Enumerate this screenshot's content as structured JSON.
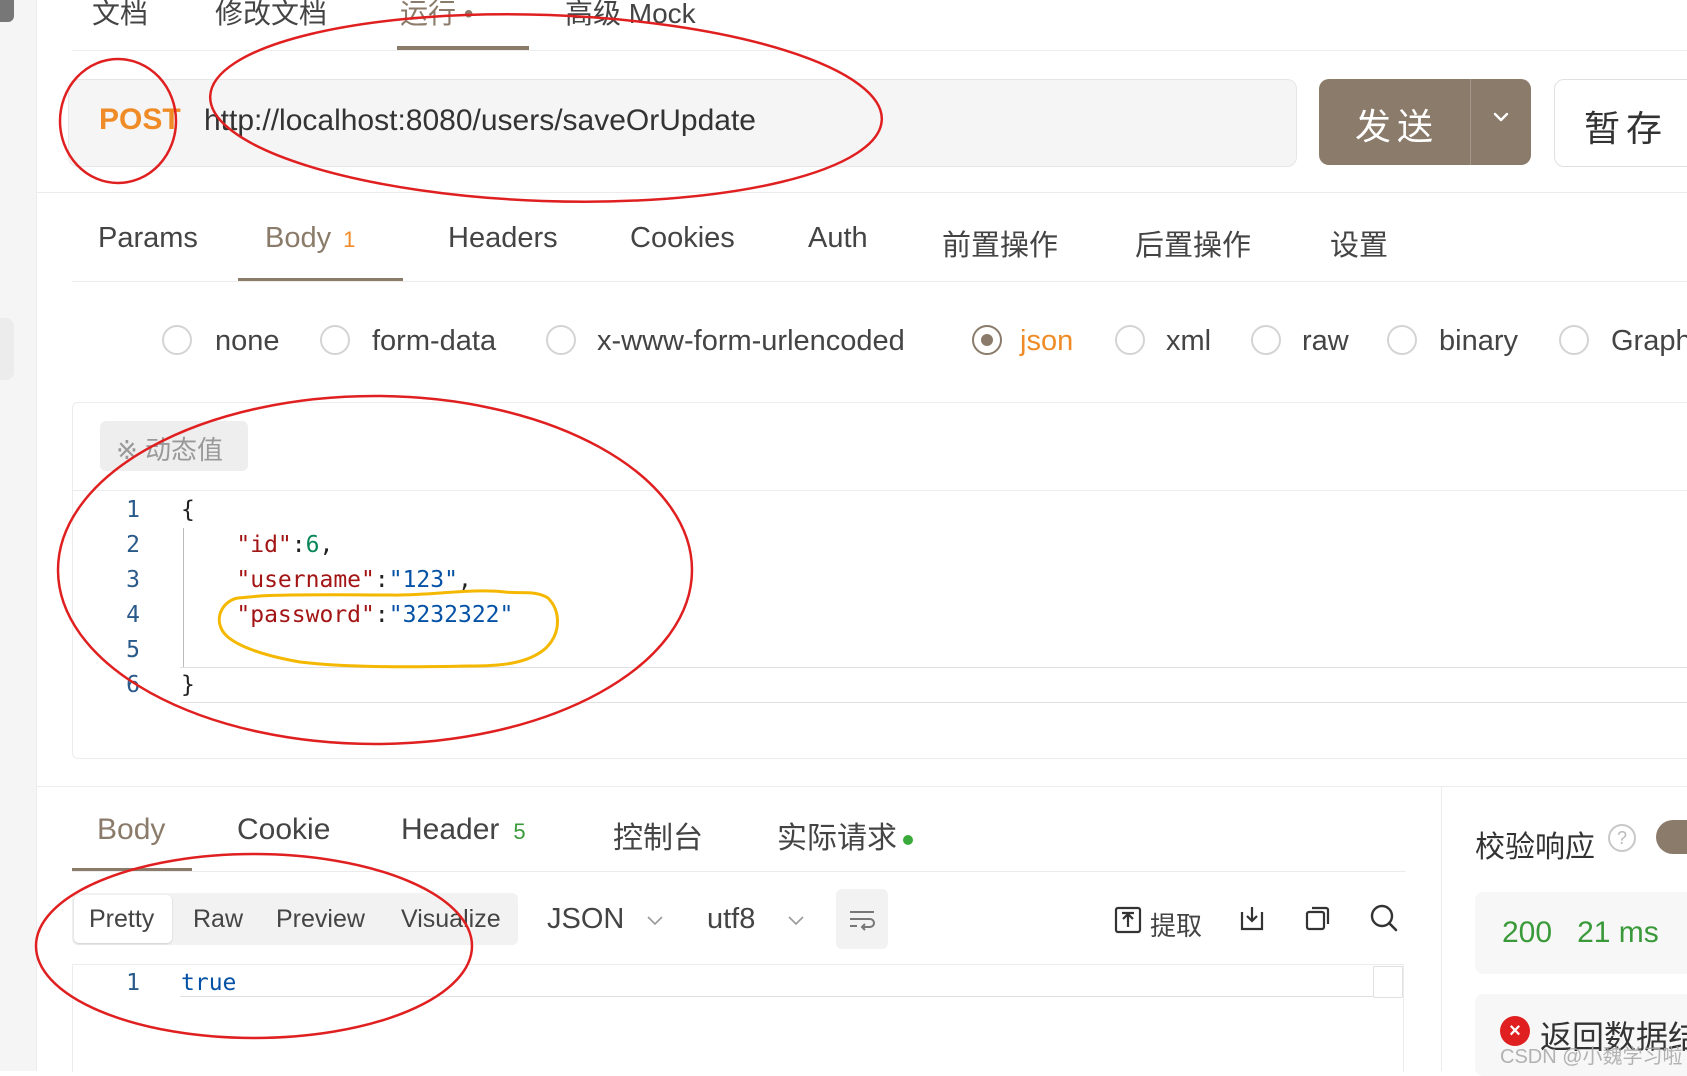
{
  "top_tabs": [
    "文档",
    "修改文档",
    "运行 •",
    "高级 Mock"
  ],
  "request": {
    "method": "POST",
    "url": "http://localhost:8080/users/saveOrUpdate",
    "send_label": "发送",
    "save_label": "暂存"
  },
  "request_tabs": [
    {
      "label": "Params"
    },
    {
      "label": "Body",
      "badge": "1"
    },
    {
      "label": "Headers"
    },
    {
      "label": "Cookies"
    },
    {
      "label": "Auth"
    },
    {
      "label": "前置操作"
    },
    {
      "label": "后置操作"
    },
    {
      "label": "设置"
    }
  ],
  "body_types": [
    "none",
    "form-data",
    "x-www-form-urlencoded",
    "json",
    "xml",
    "raw",
    "binary",
    "Graph"
  ],
  "body_type_selected": "json",
  "dynamic_value_label": "※ 动态值",
  "editor": {
    "line_numbers": [
      "1",
      "2",
      "3",
      "4",
      "5",
      "6"
    ],
    "lines": [
      {
        "parts": [
          {
            "t": "{",
            "c": "p"
          }
        ]
      },
      {
        "parts": [
          {
            "t": "    ",
            "c": "p"
          },
          {
            "t": "\"id\"",
            "c": "k"
          },
          {
            "t": ":",
            "c": "p"
          },
          {
            "t": "6",
            "c": "n"
          },
          {
            "t": ",",
            "c": "p"
          }
        ]
      },
      {
        "parts": [
          {
            "t": "    ",
            "c": "p"
          },
          {
            "t": "\"username\"",
            "c": "k"
          },
          {
            "t": ":",
            "c": "p"
          },
          {
            "t": "\"123\"",
            "c": "s"
          },
          {
            "t": ",",
            "c": "p"
          }
        ]
      },
      {
        "parts": [
          {
            "t": "    ",
            "c": "p"
          },
          {
            "t": "\"password\"",
            "c": "k"
          },
          {
            "t": ":",
            "c": "p"
          },
          {
            "t": "\"3232322\"",
            "c": "s"
          }
        ]
      },
      {
        "parts": []
      },
      {
        "parts": [
          {
            "t": "}",
            "c": "p"
          }
        ]
      }
    ]
  },
  "response_tabs": [
    {
      "label": "Body"
    },
    {
      "label": "Cookie"
    },
    {
      "label": "Header",
      "badge": "5"
    },
    {
      "label": "控制台"
    },
    {
      "label": "实际请求"
    }
  ],
  "view_modes": [
    "Pretty",
    "Raw",
    "Preview",
    "Visualize"
  ],
  "format": "JSON",
  "encoding": "utf8",
  "extract_label": "提取",
  "response_body": {
    "line_number": "1",
    "value": "true"
  },
  "verify_label": "校验响应",
  "status": {
    "code": "200",
    "time": "21 ms"
  },
  "error_label": "返回数据结",
  "watermark": "CSDN @小魏学习啦",
  "colors": {
    "accent": "#8b7b6a",
    "method": "#f08c28",
    "success": "#3a9a3a",
    "error": "#e02020",
    "annotation_red": "#e02020",
    "annotation_yellow": "#f5b800"
  }
}
